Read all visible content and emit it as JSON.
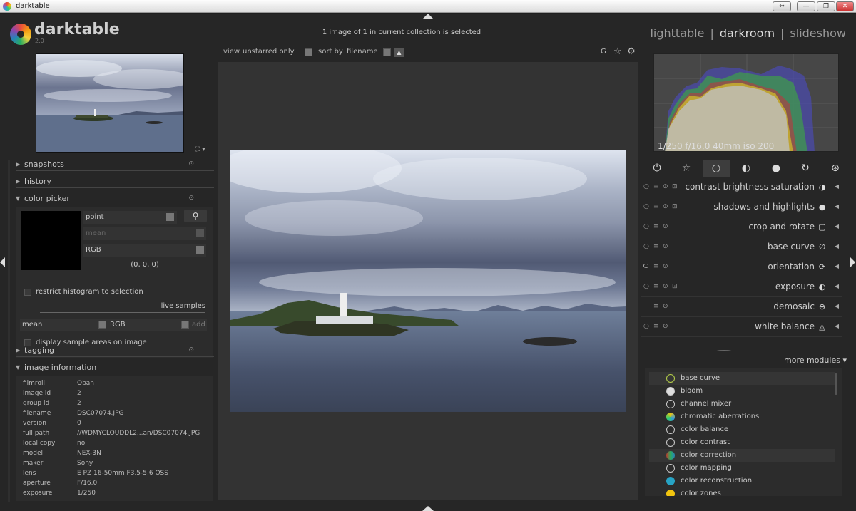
{
  "window": {
    "title": "darktable",
    "controls": [
      "⇔",
      "—",
      "❐",
      "✕"
    ]
  },
  "logo": {
    "name": "darktable",
    "version": "2.0"
  },
  "status": "1 image of 1 in current collection is selected",
  "views": {
    "lighttable": "lighttable",
    "darkroom": "darkroom",
    "slideshow": "slideshow",
    "sep": "|"
  },
  "toolbar": {
    "view": "view",
    "view_value": "unstarred only",
    "sort": "sort by",
    "sort_value": "filename",
    "grouping": "G",
    "star": "☆",
    "gear": "⚙",
    "sort_dir": "▲"
  },
  "left": {
    "snapshots": "snapshots",
    "history": "history",
    "color_picker": "color picker",
    "tagging": "tagging",
    "image_information": "image information",
    "thumb_menu": "⛶ ▾"
  },
  "picker": {
    "mode": "point",
    "stat": "mean",
    "model": "RGB",
    "values": "(0, 0, 0)",
    "restrict": "restrict histogram to selection",
    "live_samples": "live samples",
    "sample_stat": "mean",
    "sample_model": "RGB",
    "add": "add",
    "display_areas": "display sample areas on image"
  },
  "info": [
    {
      "k": "filmroll",
      "v": "Oban"
    },
    {
      "k": "image id",
      "v": "2"
    },
    {
      "k": "group id",
      "v": "2"
    },
    {
      "k": "filename",
      "v": "DSC07074.JPG"
    },
    {
      "k": "version",
      "v": "0"
    },
    {
      "k": "full path",
      "v": "//WDMYCLOUDDL2...an/DSC07074.JPG"
    },
    {
      "k": "local copy",
      "v": "no"
    },
    {
      "k": "model",
      "v": "NEX-3N"
    },
    {
      "k": "maker",
      "v": "Sony"
    },
    {
      "k": "lens",
      "v": "E PZ 16-50mm F3.5-5.6 OSS"
    },
    {
      "k": "aperture",
      "v": "F/16.0"
    },
    {
      "k": "exposure",
      "v": "1/250"
    }
  ],
  "histogram": {
    "caption": "1/250 f/16,0 40mm iso 200"
  },
  "module_groups": [
    "⏻",
    "☆",
    "○",
    "◐",
    "●",
    "↻",
    "⊛"
  ],
  "modules": [
    {
      "name": "contrast brightness saturation",
      "icon": "◑"
    },
    {
      "name": "shadows and highlights",
      "icon": "●"
    },
    {
      "name": "crop and rotate",
      "icon": "▢"
    },
    {
      "name": "base curve",
      "icon": "∅"
    },
    {
      "name": "orientation",
      "icon": "⟳"
    },
    {
      "name": "exposure",
      "icon": "◐"
    },
    {
      "name": "demosaic",
      "icon": "⊕"
    },
    {
      "name": "white balance",
      "icon": "◬"
    }
  ],
  "more_modules": "more modules ▾",
  "module_list": [
    {
      "name": "base curve",
      "hl": true
    },
    {
      "name": "bloom",
      "hl": false
    },
    {
      "name": "channel mixer",
      "hl": false
    },
    {
      "name": "chromatic aberrations",
      "hl": false
    },
    {
      "name": "color balance",
      "hl": false
    },
    {
      "name": "color contrast",
      "hl": false
    },
    {
      "name": "color correction",
      "hl": true
    },
    {
      "name": "color mapping",
      "hl": false
    },
    {
      "name": "color reconstruction",
      "hl": false
    },
    {
      "name": "color zones",
      "hl": false
    }
  ],
  "colors": {
    "accent": "#cfcfcf",
    "bg": "#262626",
    "panel": "#2c2c2c"
  }
}
